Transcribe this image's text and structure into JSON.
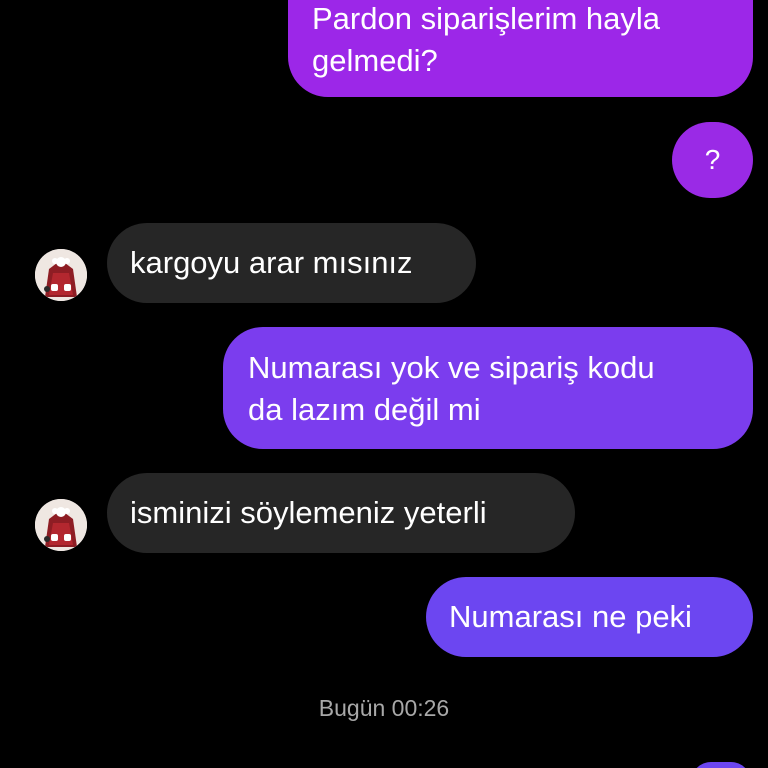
{
  "messages": [
    {
      "sender": "me",
      "lines": [
        "Pardon siparişlerim hayla",
        "gelmedi?"
      ]
    },
    {
      "sender": "me",
      "lines": [
        "?"
      ]
    },
    {
      "sender": "them",
      "lines": [
        "kargoyu arar mısınız"
      ]
    },
    {
      "sender": "me",
      "lines": [
        "Numarası yok ve sipariş kodu",
        "da lazım değil mi"
      ]
    },
    {
      "sender": "them",
      "lines": [
        "isminizi söylemeniz yeterli"
      ]
    },
    {
      "sender": "me",
      "lines": [
        "Numarası ne peki"
      ]
    }
  ],
  "timestamp": "Bugün 00:26",
  "colors": {
    "background": "#000000",
    "incoming_bubble": "#262626",
    "outgoing_gradient_top": "#9c27e8",
    "outgoing_gradient_bottom": "#6c46f1",
    "text": "#ffffff",
    "timestamp_text": "#a8a8a8"
  },
  "icons": {
    "avatar": "avatar-red-dress-thumbnail"
  }
}
